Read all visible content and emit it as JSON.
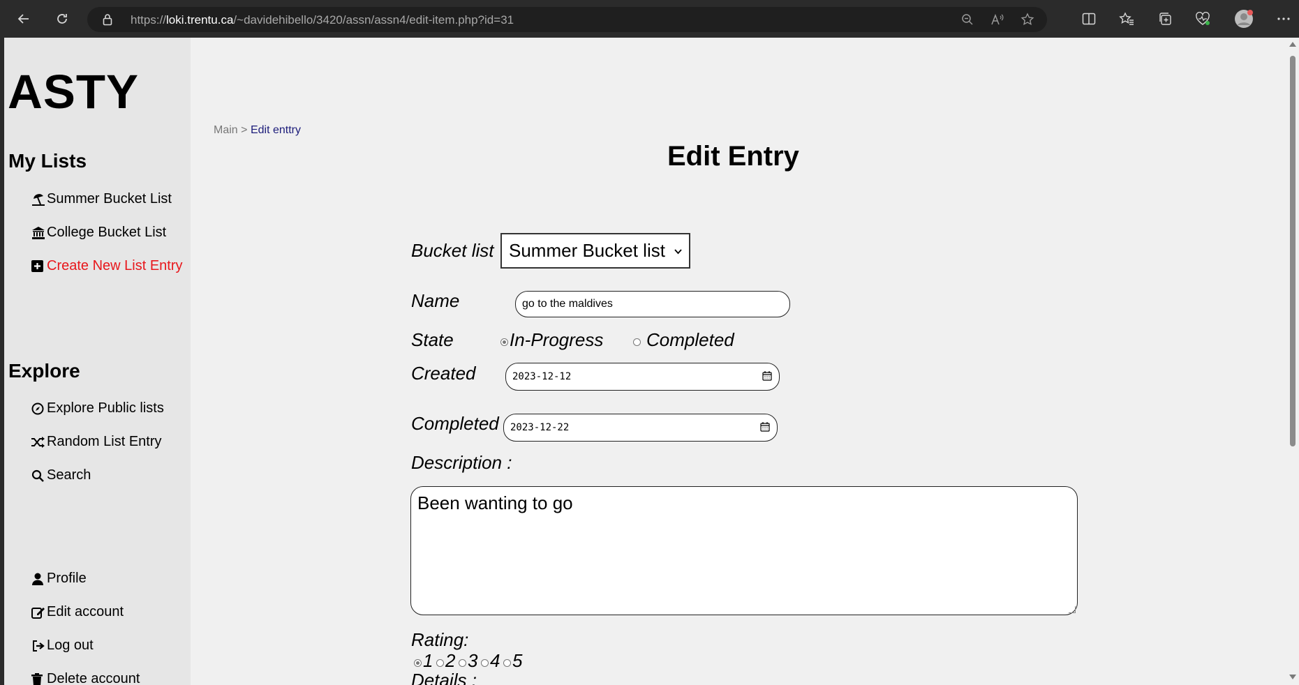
{
  "browser": {
    "url_prefix": "https://",
    "url_domain": "loki.trentu.ca",
    "url_path": "/~davidehibello/3420/assn/assn4/edit-item.php?id=31"
  },
  "sidebar": {
    "logo": "ASTY",
    "my_lists_title": "My Lists",
    "my_lists": [
      {
        "label": "Summer Bucket List",
        "icon": "umbrella-beach-icon"
      },
      {
        "label": "College Bucket List",
        "icon": "building-columns-icon"
      },
      {
        "label": "Create New List Entry",
        "icon": "plus-square-icon",
        "color": "#e8161b"
      }
    ],
    "explore_title": "Explore",
    "explore": [
      {
        "label": "Explore Public lists",
        "icon": "compass-icon"
      },
      {
        "label": "Random List Entry",
        "icon": "shuffle-icon"
      },
      {
        "label": "Search",
        "icon": "search-icon"
      }
    ],
    "account": [
      {
        "label": "Profile",
        "icon": "user-icon"
      },
      {
        "label": "Edit account",
        "icon": "edit-icon"
      },
      {
        "label": "Log out",
        "icon": "logout-icon"
      },
      {
        "label": "Delete account",
        "icon": "trash-icon"
      }
    ]
  },
  "breadcrumb": {
    "home": "Main",
    "separator": ">",
    "current": "Edit enttry"
  },
  "form": {
    "title": "Edit Entry",
    "bucket_list_label": "Bucket list",
    "bucket_list_value": "Summer Bucket list",
    "name_label": "Name",
    "name_value": "go to the maldives",
    "state_label": "State",
    "state_options": [
      "In-Progress",
      "Completed"
    ],
    "state_selected": "In-Progress",
    "created_label": "Created",
    "created_value": "2023-12-12",
    "completed_label": "Completed",
    "completed_value": "2023-12-22",
    "description_label": "Description :",
    "description_value": "Been wanting to go",
    "rating_label": "Rating:",
    "rating_options": [
      "1",
      "2",
      "3",
      "4",
      "5"
    ],
    "rating_selected": "1",
    "details_label": "Details :"
  }
}
